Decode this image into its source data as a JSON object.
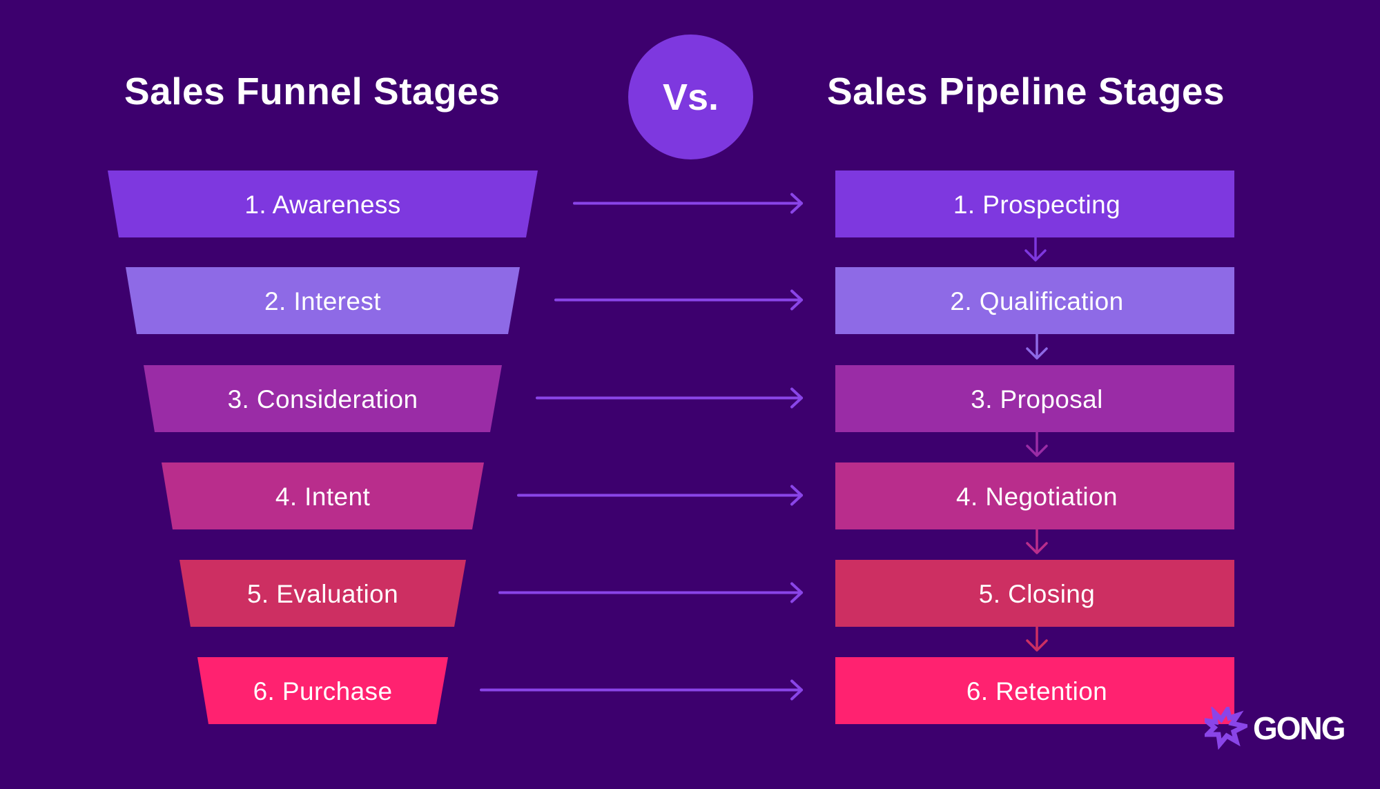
{
  "titles": {
    "left": "Sales Funnel Stages",
    "right": "Sales Pipeline Stages",
    "vs": "Vs."
  },
  "colors": {
    "background": "#3d006e",
    "arrow": "#8a45e8",
    "stages": [
      "#7e38df",
      "#8e6ae6",
      "#9a2ca6",
      "#b92d8c",
      "#cd2f62",
      "#ff2270"
    ]
  },
  "funnel_stages": [
    {
      "label": "1. Awareness"
    },
    {
      "label": "2. Interest"
    },
    {
      "label": "3. Consideration"
    },
    {
      "label": "4. Intent"
    },
    {
      "label": "5. Evaluation"
    },
    {
      "label": "6. Purchase"
    }
  ],
  "pipeline_stages": [
    {
      "label": "1. Prospecting"
    },
    {
      "label": "2. Qualification"
    },
    {
      "label": "3. Proposal"
    },
    {
      "label": "4. Negotiation"
    },
    {
      "label": "5. Closing"
    },
    {
      "label": "6. Retention"
    }
  ],
  "logo": {
    "text": "GONG",
    "icon": "starburst-icon"
  }
}
